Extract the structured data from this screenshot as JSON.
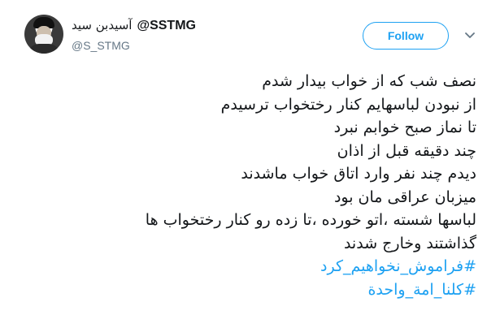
{
  "author": {
    "display_name": "آسیدبن سید",
    "username": "@SSTMG",
    "handle": "@S_STMG"
  },
  "actions": {
    "follow_label": "Follow"
  },
  "tweet": {
    "lines": [
      "نصف شب که از خواب بیدار شدم",
      "از نبودن لباسهایم کنار رختخواب ترسیدم",
      "تا نماز صبح خوابم نبرد",
      "چند دقیقه قبل از اذان",
      "دیدم چند نفر وارد اتاق خواب ماشدند",
      "میزبان عراقی مان بود",
      "لباسها شسته ،اتو خورده ،تا زده رو کنار رختخواب ها",
      "گذاشتند وخارج شدند"
    ],
    "hashtags": [
      "#فراموش_نخواهیم_کرد",
      "#كلنا_امة_واحدة"
    ]
  },
  "colors": {
    "accent": "#1da1f2",
    "text": "#14171a",
    "secondary_text": "#657786"
  },
  "icons": {
    "avatar": "profile-photo",
    "menu": "chevron-down-icon"
  }
}
